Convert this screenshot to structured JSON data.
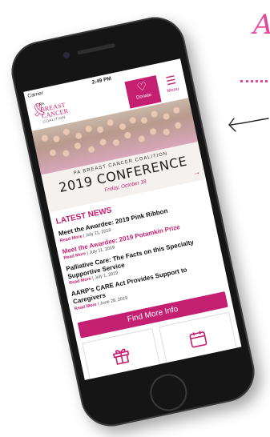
{
  "background": {
    "headline_fragment": "A",
    "accent_color": "#e2489a"
  },
  "status_bar": {
    "carrier": "Carrier",
    "time": "2:49 PM"
  },
  "app_header": {
    "logo": {
      "small": "PA",
      "line1": "BREAST",
      "line2": "CANCER",
      "line3": "COALITION",
      "icon": "ribbon-icon"
    },
    "donate_label": "Donate",
    "menu_label": "Menu",
    "brand_color": "#c41f70"
  },
  "banner": {
    "small_text": "PA BREAST CANCER COALITION",
    "big_text": "2019 CONFERENCE",
    "date_text": "Friday, October 18",
    "arrow": "→"
  },
  "latest_news": {
    "heading": "LATEST NEWS",
    "items": [
      {
        "title": "Meet the Awardee: 2019 Pink Ribbon",
        "read_more": "Read More",
        "date": "July 11, 2019",
        "pink": false
      },
      {
        "title": "Meet the Awardee: 2019 Potamkin Prize",
        "read_more": "Read More",
        "date": "July 11, 2019",
        "pink": true
      },
      {
        "title": "Palliative Care: The Facts on this Specialty Supportive Service",
        "read_more": "Read More",
        "date": "July 1, 2019",
        "pink": false
      },
      {
        "title": "AARP's CARE Act Provides Support to Caregivers",
        "read_more": "Read More",
        "date": "June 28, 2019",
        "pink": false
      }
    ]
  },
  "cta": {
    "find_more": "Find More Info"
  },
  "tiles": [
    {
      "icon": "gift-icon"
    },
    {
      "icon": "calendar-icon"
    }
  ]
}
